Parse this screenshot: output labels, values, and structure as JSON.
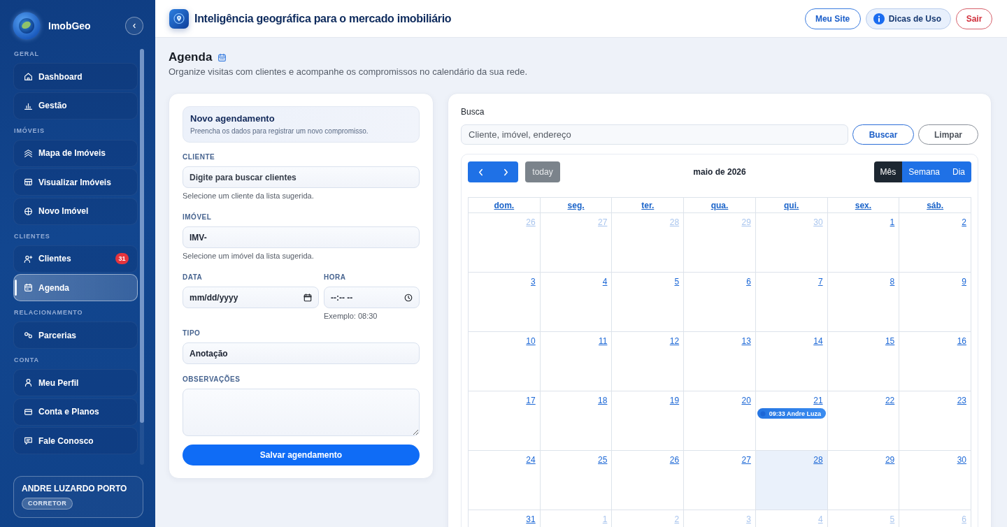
{
  "sidebar": {
    "brand": "ImobGeo",
    "sections": [
      {
        "title": "GERAL",
        "items": [
          {
            "label": "Dashboard",
            "selected": false
          },
          {
            "label": "Gestão",
            "selected": false
          }
        ]
      },
      {
        "title": "IMÓVEIS",
        "items": [
          {
            "label": "Mapa de Imóveis",
            "selected": false
          },
          {
            "label": "Visualizar Imóveis",
            "selected": false
          },
          {
            "label": "Novo Imóvel",
            "selected": false
          }
        ]
      },
      {
        "title": "CLIENTES",
        "items": [
          {
            "label": "Clientes",
            "selected": false,
            "badge": "31"
          },
          {
            "label": "Agenda",
            "selected": true
          }
        ]
      },
      {
        "title": "RELACIONAMENTO",
        "items": [
          {
            "label": "Parcerias",
            "selected": false
          }
        ]
      },
      {
        "title": "CONTA",
        "items": [
          {
            "label": "Meu Perfil",
            "selected": false
          },
          {
            "label": "Conta e Planos",
            "selected": false
          },
          {
            "label": "Fale Conosco",
            "selected": false
          }
        ]
      }
    ],
    "user": {
      "name": "ANDRE LUZARDO PORTO",
      "role": "CORRETOR"
    }
  },
  "header": {
    "title": "Inteligência geográfica para o mercado imobiliário",
    "buttons": [
      {
        "label": "Meu Site",
        "kind": "outline"
      },
      {
        "label": "Dicas de Uso",
        "kind": "info"
      },
      {
        "label": "Sair",
        "kind": "danger"
      }
    ]
  },
  "page": {
    "title": "Agenda",
    "subtitle": "Organize visitas com clientes e acompanhe os compromissos no calendário da sua rede."
  },
  "form": {
    "title": "Novo agendamento",
    "subtitle": "Preencha os dados para registrar um novo compromisso.",
    "client": {
      "label": "CLIENTE",
      "placeholder": "Digite para buscar clientes",
      "help": "Selecione um cliente da lista sugerida."
    },
    "property": {
      "label": "IMÓVEL",
      "value": "IMV-",
      "help": "Selecione um imóvel da lista sugerida."
    },
    "date": {
      "label": "DATA",
      "placeholder": "mm/dd/yyyy"
    },
    "time": {
      "label": "HORA",
      "placeholder": "--:-- --",
      "help": "Exemplo: 08:30"
    },
    "type": {
      "label": "TIPO",
      "value": "Anotação"
    },
    "notes": {
      "label": "OBSERVAÇÕES"
    },
    "submit": "Salvar agendamento"
  },
  "calendar_panel": {
    "search": {
      "label": "Busca",
      "placeholder": "Cliente, imóvel, endereço"
    },
    "search_button": "Buscar",
    "clear_button": "Limpar",
    "calendar": {
      "today_button": {
        "label": "today",
        "disabled": true
      },
      "title": "maio de 2026",
      "views": [
        {
          "label": "Mês",
          "selected": true
        },
        {
          "label": "Semana",
          "selected": false
        },
        {
          "label": "Dia",
          "selected": false
        }
      ],
      "weekdays": [
        "dom.",
        "seg.",
        "ter.",
        "qua.",
        "qui.",
        "sex.",
        "sáb."
      ],
      "weeks": [
        [
          {
            "day": "26",
            "outside": true,
            "today": false
          },
          {
            "day": "27",
            "outside": true,
            "today": false
          },
          {
            "day": "28",
            "outside": true,
            "today": false
          },
          {
            "day": "29",
            "outside": true,
            "today": false
          },
          {
            "day": "30",
            "outside": true,
            "today": false
          },
          {
            "day": "1",
            "outside": false,
            "today": false
          },
          {
            "day": "2",
            "outside": false,
            "today": false
          }
        ],
        [
          {
            "day": "3",
            "outside": false,
            "today": false
          },
          {
            "day": "4",
            "outside": false,
            "today": false
          },
          {
            "day": "5",
            "outside": false,
            "today": false
          },
          {
            "day": "6",
            "outside": false,
            "today": false
          },
          {
            "day": "7",
            "outside": false,
            "today": false
          },
          {
            "day": "8",
            "outside": false,
            "today": false
          },
          {
            "day": "9",
            "outside": false,
            "today": false
          }
        ],
        [
          {
            "day": "10",
            "outside": false,
            "today": false
          },
          {
            "day": "11",
            "outside": false,
            "today": false
          },
          {
            "day": "12",
            "outside": false,
            "today": false
          },
          {
            "day": "13",
            "outside": false,
            "today": false
          },
          {
            "day": "14",
            "outside": false,
            "today": false
          },
          {
            "day": "15",
            "outside": false,
            "today": false
          },
          {
            "day": "16",
            "outside": false,
            "today": false
          }
        ],
        [
          {
            "day": "17",
            "outside": false,
            "today": false
          },
          {
            "day": "18",
            "outside": false,
            "today": false
          },
          {
            "day": "19",
            "outside": false,
            "today": false
          },
          {
            "day": "20",
            "outside": false,
            "today": false
          },
          {
            "day": "21",
            "outside": false,
            "today": false,
            "events": [
              {
                "time": "09:33",
                "title": "Andre Luza"
              }
            ]
          },
          {
            "day": "22",
            "outside": false,
            "today": false
          },
          {
            "day": "23",
            "outside": false,
            "today": false
          }
        ],
        [
          {
            "day": "24",
            "outside": false,
            "today": false
          },
          {
            "day": "25",
            "outside": false,
            "today": false
          },
          {
            "day": "26",
            "outside": false,
            "today": false
          },
          {
            "day": "27",
            "outside": false,
            "today": false
          },
          {
            "day": "28",
            "outside": false,
            "today": true
          },
          {
            "day": "29",
            "outside": false,
            "today": false
          },
          {
            "day": "30",
            "outside": false,
            "today": false
          }
        ],
        [
          {
            "day": "31",
            "outside": false,
            "today": false
          },
          {
            "day": "1",
            "outside": true,
            "today": false
          },
          {
            "day": "2",
            "outside": true,
            "today": false
          },
          {
            "day": "3",
            "outside": true,
            "today": false
          },
          {
            "day": "4",
            "outside": true,
            "today": false
          },
          {
            "day": "5",
            "outside": true,
            "today": false
          },
          {
            "day": "6",
            "outside": true,
            "today": false
          }
        ]
      ]
    }
  }
}
